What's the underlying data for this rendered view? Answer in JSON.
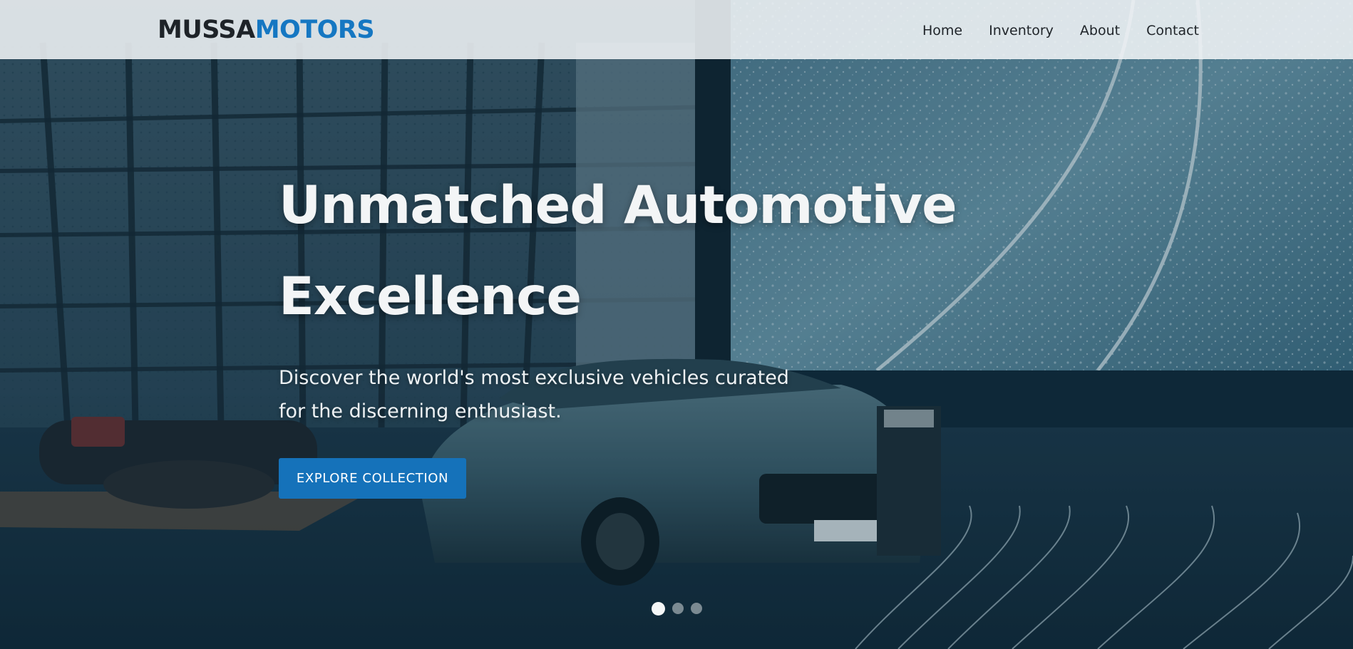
{
  "brand": {
    "name_part1": "MUSSA",
    "name_part2": "MOTORS",
    "color_dark": "#1e2328",
    "color_accent": "#1577c2"
  },
  "nav": {
    "items": [
      {
        "label": "Home"
      },
      {
        "label": "Inventory"
      },
      {
        "label": "About"
      },
      {
        "label": "Contact"
      }
    ]
  },
  "hero": {
    "title": "Unmatched Automotive Excellence",
    "subtitle": "Discover the world's most exclusive vehicles curated for the discerning enthusiast.",
    "cta_label": "EXPLORE COLLECTION",
    "cta_color": "#1572ba",
    "background_image": "car-showroom-photo",
    "slides_total": 3,
    "active_slide": 1
  }
}
